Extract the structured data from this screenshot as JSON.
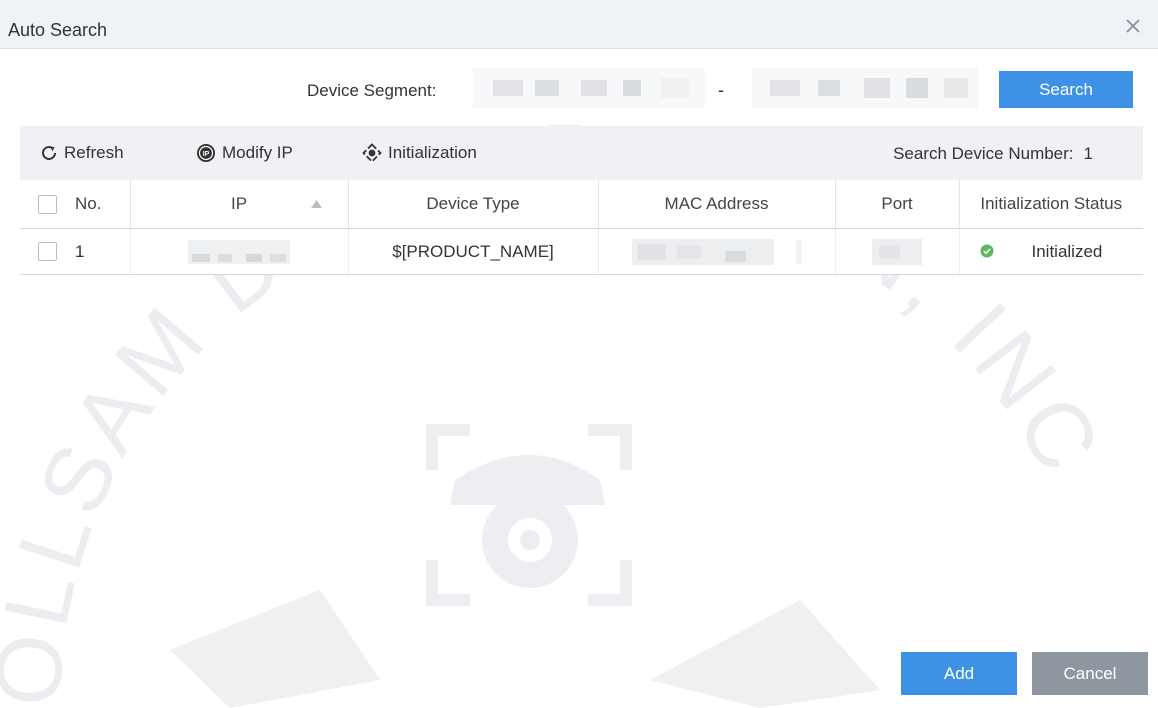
{
  "dialog": {
    "title": "Auto Search"
  },
  "watermark": {
    "text": "OLLSAM DISTRIBUTION, INC",
    "color": "#e9ebee"
  },
  "segment": {
    "label": "Device Segment:",
    "separator": "-",
    "search_label": "Search"
  },
  "toolbar": {
    "refresh_label": "Refresh",
    "modify_ip_label": "Modify IP",
    "initialization_label": "Initialization",
    "search_count_label": "Search Device Number:",
    "search_count_value": "1"
  },
  "table": {
    "headers": {
      "no": "No.",
      "ip": "IP",
      "device_type": "Device Type",
      "mac": "MAC Address",
      "port": "Port",
      "status": "Initialization Status"
    },
    "rows": [
      {
        "no": "1",
        "device_type": "$[PRODUCT_NAME]",
        "status": "Initialized"
      }
    ]
  },
  "footer": {
    "add_label": "Add",
    "cancel_label": "Cancel"
  },
  "colors": {
    "primary": "#3d92e6",
    "secondary": "#8e969f",
    "status_ok": "#5cb85c"
  },
  "icons": {
    "close": "close-icon",
    "refresh": "refresh-icon",
    "modify_ip": "ip-icon",
    "initialization": "initialization-icon",
    "sort": "sort-ascending-icon",
    "status": "check-circle-icon"
  }
}
